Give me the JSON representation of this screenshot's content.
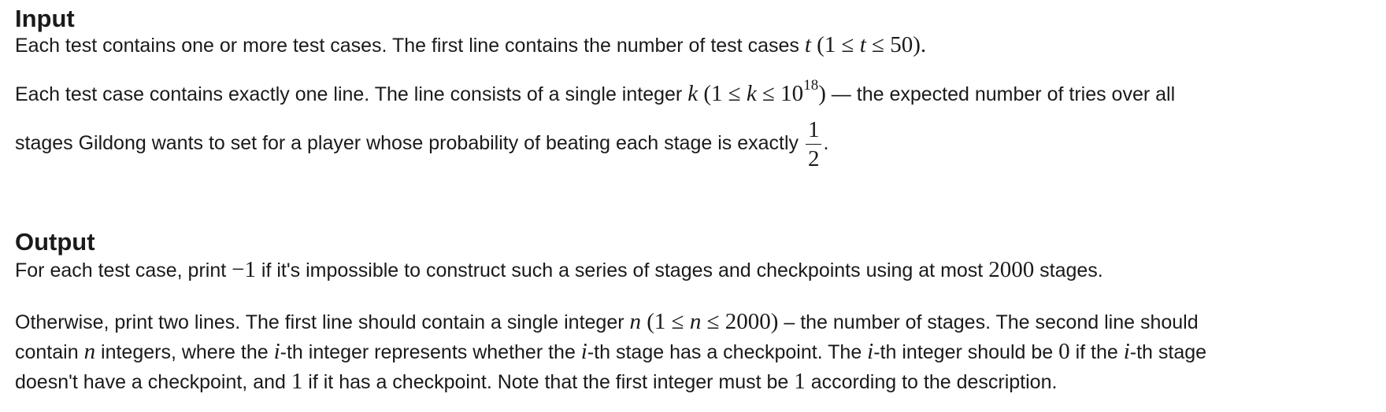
{
  "input": {
    "title": "Input",
    "p1": {
      "a": "Each test contains one or more test cases. The first line contains the number of test cases ",
      "var": "t",
      "range_open": " (1 ≤ ",
      "range_var": "t",
      "range_close": " ≤ 50).",
      "end": ""
    },
    "p2": {
      "a": "Each test case contains exactly one line. The line consists of a single integer ",
      "var": "k",
      "range_open": " (1 ≤ ",
      "range_var": "k",
      "range_mid": " ≤ 10",
      "exp": "18",
      "range_close": ")",
      "b": " — the expected number of tries over all",
      "c": "stages Gildong wants to set for a player whose probability of beating each stage is exactly ",
      "frac_num": "1",
      "frac_den": "2",
      "end": "."
    }
  },
  "output": {
    "title": "Output",
    "p1": {
      "a": "For each test case, print ",
      "neg": "−1",
      "b": " if it's impossible to construct such a series of stages and checkpoints using at most ",
      "num": "2000",
      "c": " stages."
    },
    "p2": {
      "a": "Otherwise, print two lines. The first line should contain a single integer ",
      "var": "n",
      "range_open": " (1 ≤ ",
      "range_var": "n",
      "range_close": " ≤ 2000)",
      "b": " – the number of stages. The second line should",
      "c": "contain ",
      "var2": "n",
      "d": " integers, where the ",
      "i1": "i",
      "e": "-th integer represents whether the ",
      "i2": "i",
      "f": "-th stage has a checkpoint. The ",
      "i3": "i",
      "g": "-th integer should be ",
      "zero": "0",
      "h": " if the ",
      "i4": "i",
      "j": "-th stage",
      "k": "doesn't have a checkpoint, and ",
      "one": "1",
      "l": " if it has a checkpoint. Note that the first integer must be ",
      "one2": "1",
      "m": " according to the description."
    }
  }
}
